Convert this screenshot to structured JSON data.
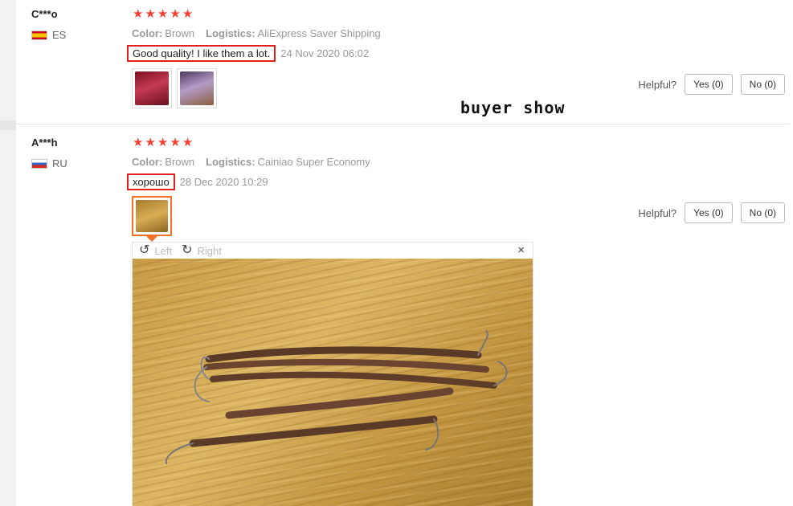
{
  "reviews": [
    {
      "user": "C***o",
      "country": "ES",
      "rating": 5,
      "color_label": "Color:",
      "color_value": "Brown",
      "logistics_label": "Logistics:",
      "logistics_value": "AliExpress Saver Shipping",
      "feedback": "Good quality! I like them a lot.",
      "date": "24 Nov 2020 06:02",
      "helpful_label": "Helpful?",
      "yes_label": "Yes (0)",
      "no_label": "No (0)"
    },
    {
      "user": "A***h",
      "country": "RU",
      "rating": 5,
      "color_label": "Color:",
      "color_value": "Brown",
      "logistics_label": "Logistics:",
      "logistics_value": "Cainiao Super Economy",
      "feedback": "хорошо",
      "date": "28 Dec 2020 10:29",
      "helpful_label": "Helpful?",
      "yes_label": "Yes (0)",
      "no_label": "No (0)"
    }
  ],
  "overlay_text": "buyer show",
  "viewer": {
    "rotate_left_label": "Left",
    "rotate_right_label": "Right",
    "close_icon": "×"
  },
  "colors": {
    "star": "#f44336",
    "highlight_border": "#e0201f",
    "active_thumb": "#f57224"
  }
}
